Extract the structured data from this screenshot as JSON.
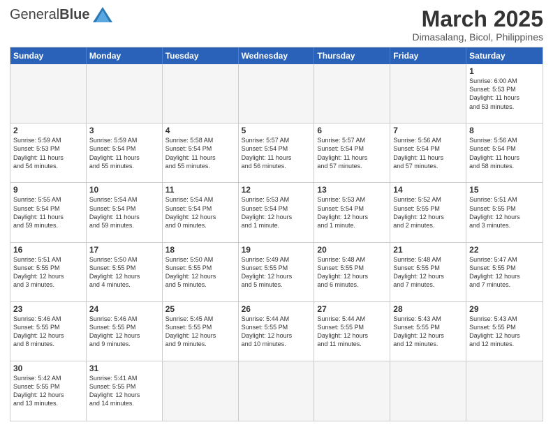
{
  "header": {
    "logo_general": "General",
    "logo_blue": "Blue",
    "month_year": "March 2025",
    "location": "Dimasalang, Bicol, Philippines"
  },
  "weekdays": [
    "Sunday",
    "Monday",
    "Tuesday",
    "Wednesday",
    "Thursday",
    "Friday",
    "Saturday"
  ],
  "cells": [
    {
      "day": "",
      "info": ""
    },
    {
      "day": "",
      "info": ""
    },
    {
      "day": "",
      "info": ""
    },
    {
      "day": "",
      "info": ""
    },
    {
      "day": "",
      "info": ""
    },
    {
      "day": "",
      "info": ""
    },
    {
      "day": "1",
      "info": "Sunrise: 6:00 AM\nSunset: 5:53 PM\nDaylight: 11 hours\nand 53 minutes."
    },
    {
      "day": "2",
      "info": "Sunrise: 5:59 AM\nSunset: 5:53 PM\nDaylight: 11 hours\nand 54 minutes."
    },
    {
      "day": "3",
      "info": "Sunrise: 5:59 AM\nSunset: 5:54 PM\nDaylight: 11 hours\nand 55 minutes."
    },
    {
      "day": "4",
      "info": "Sunrise: 5:58 AM\nSunset: 5:54 PM\nDaylight: 11 hours\nand 55 minutes."
    },
    {
      "day": "5",
      "info": "Sunrise: 5:57 AM\nSunset: 5:54 PM\nDaylight: 11 hours\nand 56 minutes."
    },
    {
      "day": "6",
      "info": "Sunrise: 5:57 AM\nSunset: 5:54 PM\nDaylight: 11 hours\nand 57 minutes."
    },
    {
      "day": "7",
      "info": "Sunrise: 5:56 AM\nSunset: 5:54 PM\nDaylight: 11 hours\nand 57 minutes."
    },
    {
      "day": "8",
      "info": "Sunrise: 5:56 AM\nSunset: 5:54 PM\nDaylight: 11 hours\nand 58 minutes."
    },
    {
      "day": "9",
      "info": "Sunrise: 5:55 AM\nSunset: 5:54 PM\nDaylight: 11 hours\nand 59 minutes."
    },
    {
      "day": "10",
      "info": "Sunrise: 5:54 AM\nSunset: 5:54 PM\nDaylight: 11 hours\nand 59 minutes."
    },
    {
      "day": "11",
      "info": "Sunrise: 5:54 AM\nSunset: 5:54 PM\nDaylight: 12 hours\nand 0 minutes."
    },
    {
      "day": "12",
      "info": "Sunrise: 5:53 AM\nSunset: 5:54 PM\nDaylight: 12 hours\nand 1 minute."
    },
    {
      "day": "13",
      "info": "Sunrise: 5:53 AM\nSunset: 5:54 PM\nDaylight: 12 hours\nand 1 minute."
    },
    {
      "day": "14",
      "info": "Sunrise: 5:52 AM\nSunset: 5:55 PM\nDaylight: 12 hours\nand 2 minutes."
    },
    {
      "day": "15",
      "info": "Sunrise: 5:51 AM\nSunset: 5:55 PM\nDaylight: 12 hours\nand 3 minutes."
    },
    {
      "day": "16",
      "info": "Sunrise: 5:51 AM\nSunset: 5:55 PM\nDaylight: 12 hours\nand 3 minutes."
    },
    {
      "day": "17",
      "info": "Sunrise: 5:50 AM\nSunset: 5:55 PM\nDaylight: 12 hours\nand 4 minutes."
    },
    {
      "day": "18",
      "info": "Sunrise: 5:50 AM\nSunset: 5:55 PM\nDaylight: 12 hours\nand 5 minutes."
    },
    {
      "day": "19",
      "info": "Sunrise: 5:49 AM\nSunset: 5:55 PM\nDaylight: 12 hours\nand 5 minutes."
    },
    {
      "day": "20",
      "info": "Sunrise: 5:48 AM\nSunset: 5:55 PM\nDaylight: 12 hours\nand 6 minutes."
    },
    {
      "day": "21",
      "info": "Sunrise: 5:48 AM\nSunset: 5:55 PM\nDaylight: 12 hours\nand 7 minutes."
    },
    {
      "day": "22",
      "info": "Sunrise: 5:47 AM\nSunset: 5:55 PM\nDaylight: 12 hours\nand 7 minutes."
    },
    {
      "day": "23",
      "info": "Sunrise: 5:46 AM\nSunset: 5:55 PM\nDaylight: 12 hours\nand 8 minutes."
    },
    {
      "day": "24",
      "info": "Sunrise: 5:46 AM\nSunset: 5:55 PM\nDaylight: 12 hours\nand 9 minutes."
    },
    {
      "day": "25",
      "info": "Sunrise: 5:45 AM\nSunset: 5:55 PM\nDaylight: 12 hours\nand 9 minutes."
    },
    {
      "day": "26",
      "info": "Sunrise: 5:44 AM\nSunset: 5:55 PM\nDaylight: 12 hours\nand 10 minutes."
    },
    {
      "day": "27",
      "info": "Sunrise: 5:44 AM\nSunset: 5:55 PM\nDaylight: 12 hours\nand 11 minutes."
    },
    {
      "day": "28",
      "info": "Sunrise: 5:43 AM\nSunset: 5:55 PM\nDaylight: 12 hours\nand 12 minutes."
    },
    {
      "day": "29",
      "info": "Sunrise: 5:43 AM\nSunset: 5:55 PM\nDaylight: 12 hours\nand 12 minutes."
    },
    {
      "day": "30",
      "info": "Sunrise: 5:42 AM\nSunset: 5:55 PM\nDaylight: 12 hours\nand 13 minutes."
    },
    {
      "day": "31",
      "info": "Sunrise: 5:41 AM\nSunset: 5:55 PM\nDaylight: 12 hours\nand 14 minutes."
    },
    {
      "day": "",
      "info": ""
    },
    {
      "day": "",
      "info": ""
    },
    {
      "day": "",
      "info": ""
    },
    {
      "day": "",
      "info": ""
    },
    {
      "day": "",
      "info": ""
    }
  ]
}
